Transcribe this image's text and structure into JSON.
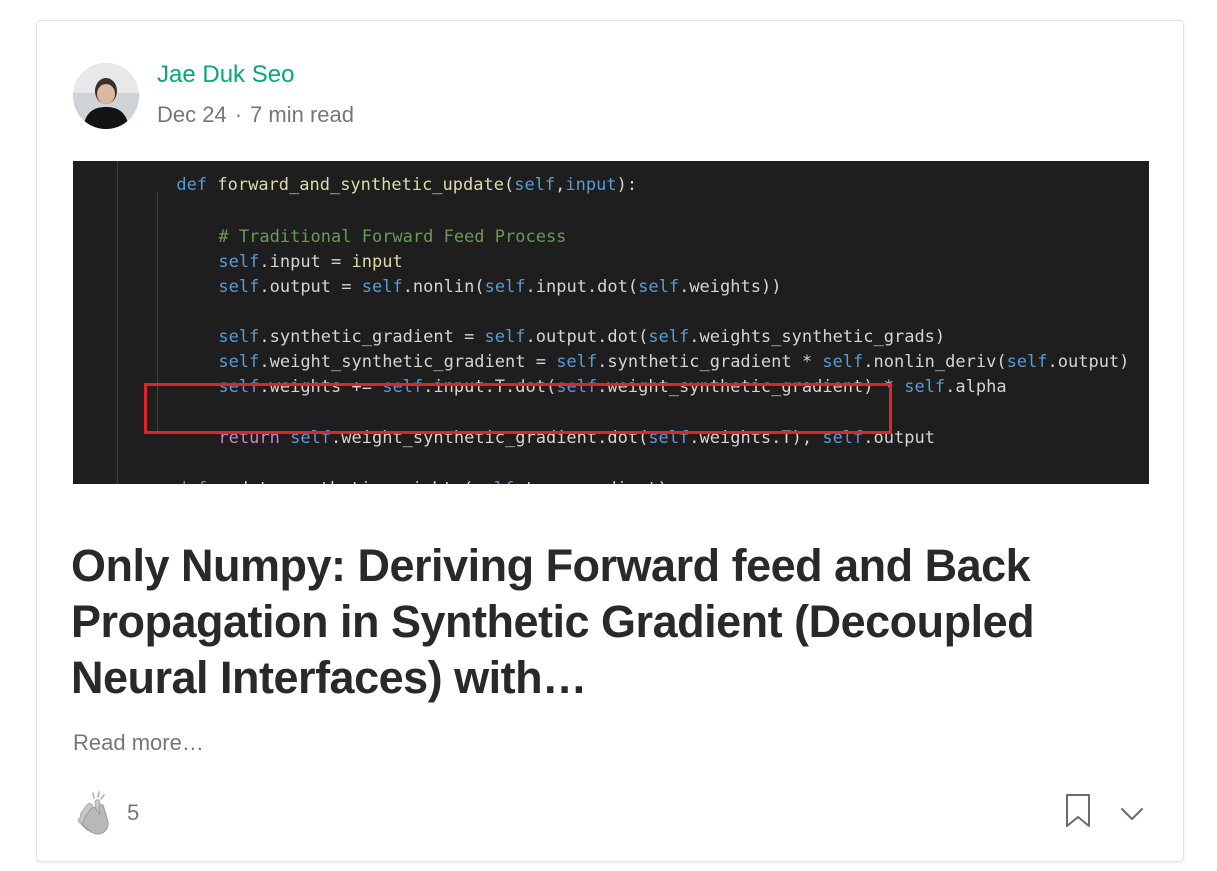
{
  "post": {
    "author": "Jae Duk Seo",
    "date": "Dec 24",
    "separator": "·",
    "read_time": "7 min read",
    "title": "Only Numpy: Deriving Forward feed and Back Propagation in Synthetic Gradient (Decoupled Neural Interfaces) with…",
    "read_more": "Read more…",
    "claps": "5"
  },
  "code_image": {
    "lines": [
      "def forward_and_synthetic_update(self,input):",
      "# Traditional Forward Feed Process",
      "self.input = input",
      "self.output = self.nonlin(self.input.dot(self.weights))",
      "self.synthetic_gradient = self.output.dot(self.weights_synthetic_grads)",
      "self.weight_synthetic_gradient = self.synthetic_gradient * self.nonlin_deriv(self.output)",
      "self.weights += self.input.T.dot(self.weight_synthetic_gradient) * self.alpha",
      "return self.weight_synthetic_gradient.dot(self.weights.T), self.output",
      "def update_synthetic_weights(self,true_gradient):"
    ],
    "highlight_color": "#e0242b"
  },
  "colors": {
    "accent": "#03a87c",
    "code_bg": "#1e1e1e"
  },
  "icons": [
    "avatar",
    "clap-icon",
    "bookmark-icon",
    "chevron-down-icon"
  ]
}
